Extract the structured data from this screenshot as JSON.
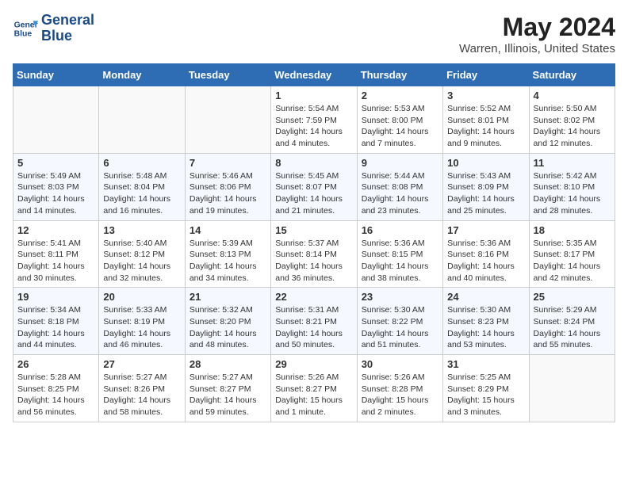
{
  "header": {
    "logo_line1": "General",
    "logo_line2": "Blue",
    "month": "May 2024",
    "location": "Warren, Illinois, United States"
  },
  "days_of_week": [
    "Sunday",
    "Monday",
    "Tuesday",
    "Wednesday",
    "Thursday",
    "Friday",
    "Saturday"
  ],
  "weeks": [
    [
      {
        "num": "",
        "info": ""
      },
      {
        "num": "",
        "info": ""
      },
      {
        "num": "",
        "info": ""
      },
      {
        "num": "1",
        "info": "Sunrise: 5:54 AM\nSunset: 7:59 PM\nDaylight: 14 hours\nand 4 minutes."
      },
      {
        "num": "2",
        "info": "Sunrise: 5:53 AM\nSunset: 8:00 PM\nDaylight: 14 hours\nand 7 minutes."
      },
      {
        "num": "3",
        "info": "Sunrise: 5:52 AM\nSunset: 8:01 PM\nDaylight: 14 hours\nand 9 minutes."
      },
      {
        "num": "4",
        "info": "Sunrise: 5:50 AM\nSunset: 8:02 PM\nDaylight: 14 hours\nand 12 minutes."
      }
    ],
    [
      {
        "num": "5",
        "info": "Sunrise: 5:49 AM\nSunset: 8:03 PM\nDaylight: 14 hours\nand 14 minutes."
      },
      {
        "num": "6",
        "info": "Sunrise: 5:48 AM\nSunset: 8:04 PM\nDaylight: 14 hours\nand 16 minutes."
      },
      {
        "num": "7",
        "info": "Sunrise: 5:46 AM\nSunset: 8:06 PM\nDaylight: 14 hours\nand 19 minutes."
      },
      {
        "num": "8",
        "info": "Sunrise: 5:45 AM\nSunset: 8:07 PM\nDaylight: 14 hours\nand 21 minutes."
      },
      {
        "num": "9",
        "info": "Sunrise: 5:44 AM\nSunset: 8:08 PM\nDaylight: 14 hours\nand 23 minutes."
      },
      {
        "num": "10",
        "info": "Sunrise: 5:43 AM\nSunset: 8:09 PM\nDaylight: 14 hours\nand 25 minutes."
      },
      {
        "num": "11",
        "info": "Sunrise: 5:42 AM\nSunset: 8:10 PM\nDaylight: 14 hours\nand 28 minutes."
      }
    ],
    [
      {
        "num": "12",
        "info": "Sunrise: 5:41 AM\nSunset: 8:11 PM\nDaylight: 14 hours\nand 30 minutes."
      },
      {
        "num": "13",
        "info": "Sunrise: 5:40 AM\nSunset: 8:12 PM\nDaylight: 14 hours\nand 32 minutes."
      },
      {
        "num": "14",
        "info": "Sunrise: 5:39 AM\nSunset: 8:13 PM\nDaylight: 14 hours\nand 34 minutes."
      },
      {
        "num": "15",
        "info": "Sunrise: 5:37 AM\nSunset: 8:14 PM\nDaylight: 14 hours\nand 36 minutes."
      },
      {
        "num": "16",
        "info": "Sunrise: 5:36 AM\nSunset: 8:15 PM\nDaylight: 14 hours\nand 38 minutes."
      },
      {
        "num": "17",
        "info": "Sunrise: 5:36 AM\nSunset: 8:16 PM\nDaylight: 14 hours\nand 40 minutes."
      },
      {
        "num": "18",
        "info": "Sunrise: 5:35 AM\nSunset: 8:17 PM\nDaylight: 14 hours\nand 42 minutes."
      }
    ],
    [
      {
        "num": "19",
        "info": "Sunrise: 5:34 AM\nSunset: 8:18 PM\nDaylight: 14 hours\nand 44 minutes."
      },
      {
        "num": "20",
        "info": "Sunrise: 5:33 AM\nSunset: 8:19 PM\nDaylight: 14 hours\nand 46 minutes."
      },
      {
        "num": "21",
        "info": "Sunrise: 5:32 AM\nSunset: 8:20 PM\nDaylight: 14 hours\nand 48 minutes."
      },
      {
        "num": "22",
        "info": "Sunrise: 5:31 AM\nSunset: 8:21 PM\nDaylight: 14 hours\nand 50 minutes."
      },
      {
        "num": "23",
        "info": "Sunrise: 5:30 AM\nSunset: 8:22 PM\nDaylight: 14 hours\nand 51 minutes."
      },
      {
        "num": "24",
        "info": "Sunrise: 5:30 AM\nSunset: 8:23 PM\nDaylight: 14 hours\nand 53 minutes."
      },
      {
        "num": "25",
        "info": "Sunrise: 5:29 AM\nSunset: 8:24 PM\nDaylight: 14 hours\nand 55 minutes."
      }
    ],
    [
      {
        "num": "26",
        "info": "Sunrise: 5:28 AM\nSunset: 8:25 PM\nDaylight: 14 hours\nand 56 minutes."
      },
      {
        "num": "27",
        "info": "Sunrise: 5:27 AM\nSunset: 8:26 PM\nDaylight: 14 hours\nand 58 minutes."
      },
      {
        "num": "28",
        "info": "Sunrise: 5:27 AM\nSunset: 8:27 PM\nDaylight: 14 hours\nand 59 minutes."
      },
      {
        "num": "29",
        "info": "Sunrise: 5:26 AM\nSunset: 8:27 PM\nDaylight: 15 hours\nand 1 minute."
      },
      {
        "num": "30",
        "info": "Sunrise: 5:26 AM\nSunset: 8:28 PM\nDaylight: 15 hours\nand 2 minutes."
      },
      {
        "num": "31",
        "info": "Sunrise: 5:25 AM\nSunset: 8:29 PM\nDaylight: 15 hours\nand 3 minutes."
      },
      {
        "num": "",
        "info": ""
      }
    ]
  ]
}
